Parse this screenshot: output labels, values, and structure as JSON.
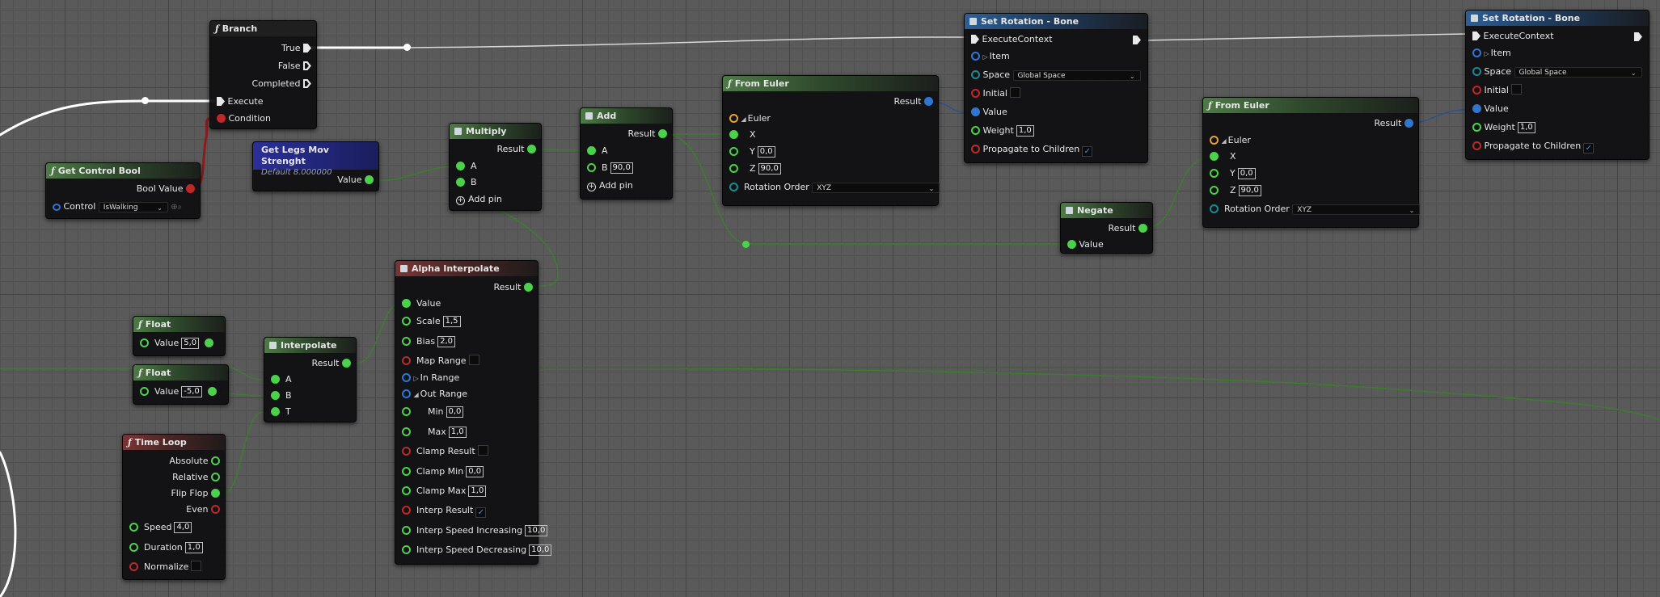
{
  "branch": {
    "title": "Branch",
    "icon": "function-icon",
    "true_label": "True",
    "false_label": "False",
    "completed_label": "Completed",
    "execute_label": "Execute",
    "condition_label": "Condition"
  },
  "get_control_bool": {
    "title": "Get Control Bool",
    "bool_value_label": "Bool Value",
    "control_label": "Control",
    "control_value": "IsWalking"
  },
  "get_legs": {
    "title": "Get Legs Mov Strenght",
    "default_text": "Default 8.000000",
    "value_label": "Value"
  },
  "multiply": {
    "title": "Multiply",
    "result_label": "Result",
    "a_label": "A",
    "b_label": "B",
    "add_pin_label": "Add pin"
  },
  "add": {
    "title": "Add",
    "result_label": "Result",
    "a_label": "A",
    "b_label": "B",
    "b_value": "90,0",
    "add_pin_label": "Add pin"
  },
  "from_euler_1": {
    "title": "From Euler",
    "result_label": "Result",
    "euler_label": "Euler",
    "x_label": "X",
    "y_label": "Y",
    "y_value": "0,0",
    "z_label": "Z",
    "z_value": "90,0",
    "rotation_order_label": "Rotation Order",
    "rotation_order_value": "XYZ"
  },
  "set_rotation_1": {
    "title": "Set Rotation - Bone",
    "execute_context_label": "ExecuteContext",
    "item_label": "Item",
    "space_label": "Space",
    "space_value": "Global Space",
    "initial_label": "Initial",
    "value_label": "Value",
    "weight_label": "Weight",
    "weight_value": "1,0",
    "propagate_label": "Propagate to Children",
    "propagate_checked": "✓"
  },
  "negate": {
    "title": "Negate",
    "result_label": "Result",
    "value_label": "Value"
  },
  "from_euler_2": {
    "title": "From Euler",
    "result_label": "Result",
    "euler_label": "Euler",
    "x_label": "X",
    "y_label": "Y",
    "y_value": "0,0",
    "z_label": "Z",
    "z_value": "90,0",
    "rotation_order_label": "Rotation Order",
    "rotation_order_value": "XYZ"
  },
  "set_rotation_2": {
    "title": "Set Rotation - Bone",
    "execute_context_label": "ExecuteContext",
    "item_label": "Item",
    "space_label": "Space",
    "space_value": "Global Space",
    "initial_label": "Initial",
    "value_label": "Value",
    "weight_label": "Weight",
    "weight_value": "1,0",
    "propagate_label": "Propagate to Children",
    "propagate_checked": "✓"
  },
  "float_1": {
    "title": "Float",
    "value_label": "Value",
    "value": "5,0"
  },
  "float_2": {
    "title": "Float",
    "value_label": "Value",
    "value": "-5,0"
  },
  "interpolate": {
    "title": "Interpolate",
    "result_label": "Result",
    "a_label": "A",
    "b_label": "B",
    "t_label": "T"
  },
  "alpha_interpolate": {
    "title": "Alpha Interpolate",
    "result_label": "Result",
    "value_label": "Value",
    "scale_label": "Scale",
    "scale_value": "1,5",
    "bias_label": "Bias",
    "bias_value": "2,0",
    "map_range_label": "Map Range",
    "in_range_label": "In Range",
    "out_range_label": "Out Range",
    "min_label": "Min",
    "min_value": "0,0",
    "max_label": "Max",
    "max_value": "1,0",
    "clamp_result_label": "Clamp Result",
    "clamp_min_label": "Clamp Min",
    "clamp_min_value": "0,0",
    "clamp_max_label": "Clamp Max",
    "clamp_max_value": "1,0",
    "interp_result_label": "Interp Result",
    "interp_result_checked": "✓",
    "interp_speed_inc_label": "Interp Speed Increasing",
    "interp_speed_inc_value": "10,0",
    "interp_speed_dec_label": "Interp Speed Decreasing",
    "interp_speed_dec_value": "10,0"
  },
  "time_loop": {
    "title": "Time Loop",
    "absolute_label": "Absolute",
    "relative_label": "Relative",
    "flip_flop_label": "Flip Flop",
    "even_label": "Even",
    "speed_label": "Speed",
    "speed_value": "4,0",
    "duration_label": "Duration",
    "duration_value": "1,0",
    "normalize_label": "Normalize"
  },
  "colors": {
    "float_pin": "#4bd14b",
    "bool_pin": "#c02828",
    "struct_pin": "#2f76d1",
    "exec_wire": "#ffffff",
    "float_wire": "#3c7d2f"
  }
}
